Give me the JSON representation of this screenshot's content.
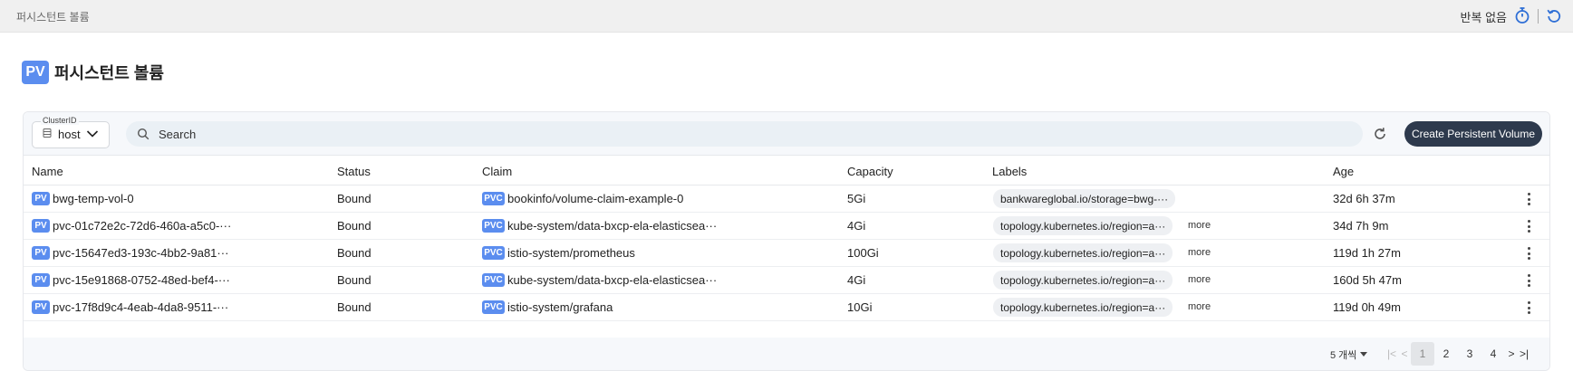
{
  "topbar": {
    "breadcrumb": "퍼시스턴트 볼륨",
    "repeat_label": "반복 없음",
    "timer_icon": "stopwatch-icon",
    "reset_icon": "undo-icon"
  },
  "page": {
    "badge": "PV",
    "title": "퍼시스턴트 볼륨"
  },
  "toolbar": {
    "cluster_label": "ClusterID",
    "cluster_value": "host",
    "search_placeholder": "Search",
    "create_label": "Create Persistent Volume"
  },
  "table": {
    "columns": [
      "Name",
      "Status",
      "Claim",
      "Capacity",
      "Labels",
      "Age"
    ],
    "name_badge": "PV",
    "claim_badge": "PVC",
    "more_label": "more",
    "rows": [
      {
        "name": "bwg-temp-vol-0",
        "status": "Bound",
        "claim": "bookinfo/volume-claim-example-0",
        "capacity": "5Gi",
        "label": "bankwareglobal.io/storage=bwg-···",
        "age": "32d 6h 37m"
      },
      {
        "name": "pvc-01c72e2c-72d6-460a-a5c0-···",
        "status": "Bound",
        "claim": "kube-system/data-bxcp-ela-elasticsea···",
        "capacity": "4Gi",
        "label": "topology.kubernetes.io/region=a···",
        "age": "34d 7h 9m"
      },
      {
        "name": "pvc-15647ed3-193c-4bb2-9a81···",
        "status": "Bound",
        "claim": "istio-system/prometheus",
        "capacity": "100Gi",
        "label": "topology.kubernetes.io/region=a···",
        "age": "119d 1h 27m"
      },
      {
        "name": "pvc-15e91868-0752-48ed-bef4-···",
        "status": "Bound",
        "claim": "kube-system/data-bxcp-ela-elasticsea···",
        "capacity": "4Gi",
        "label": "topology.kubernetes.io/region=a···",
        "age": "160d 5h 47m"
      },
      {
        "name": "pvc-17f8d9c4-4eab-4da8-9511-···",
        "status": "Bound",
        "claim": "istio-system/grafana",
        "capacity": "10Gi",
        "label": "topology.kubernetes.io/region=a···",
        "age": "119d 0h 49m"
      }
    ]
  },
  "pagination": {
    "per_page": "5 개씩",
    "pages": [
      "1",
      "2",
      "3",
      "4"
    ],
    "current": "1"
  },
  "colors": {
    "badge": "#5b8def",
    "primary_button": "#2e3a4d",
    "topbar_bg": "#f0f0f0"
  }
}
